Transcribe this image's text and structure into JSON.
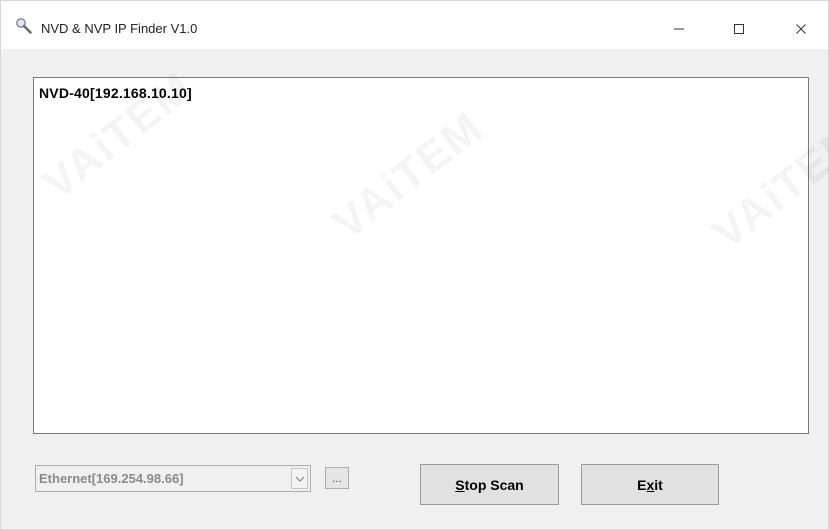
{
  "window": {
    "title": "NVD & NVP IP Finder V1.0",
    "minimize_glyph": "−",
    "maximize_glyph": "☐",
    "close_glyph": "×"
  },
  "device_list": {
    "items": [
      "NVD-40[192.168.10.10]"
    ]
  },
  "network_adapter": {
    "selected": "Ethernet[169.254.98.66]",
    "browse_label": "..."
  },
  "buttons": {
    "stop_scan_prefix": "",
    "stop_scan_mnemonic": "S",
    "stop_scan_rest": "top Scan",
    "exit_prefix": "E",
    "exit_mnemonic": "x",
    "exit_rest": "it"
  },
  "watermark": {
    "text": "VAiTEM"
  },
  "icons": {
    "app": "magnifier-icon",
    "combo_arrow": "chevron-down-icon"
  }
}
